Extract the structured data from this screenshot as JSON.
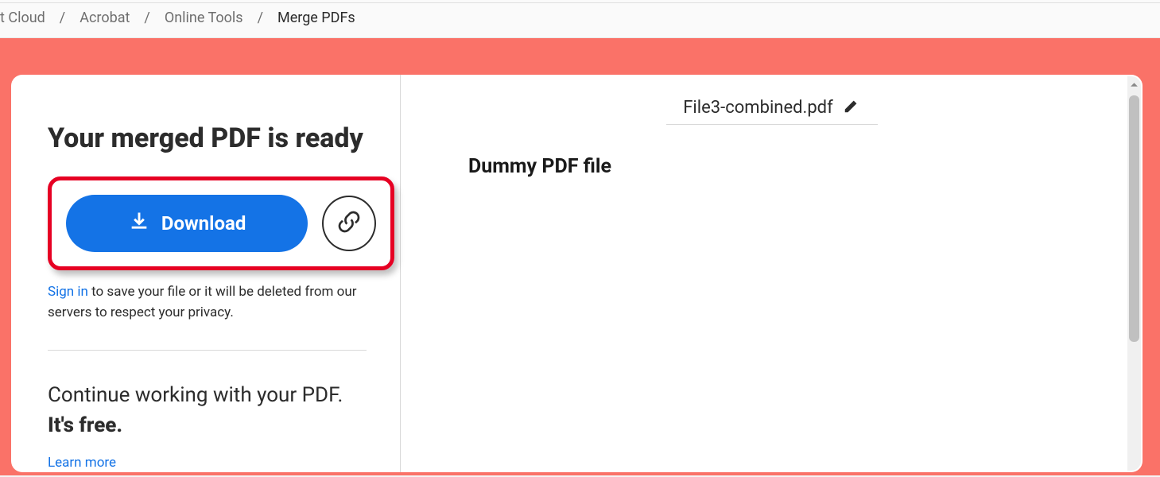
{
  "breadcrumb": {
    "items": [
      {
        "label": "t Cloud",
        "current": false
      },
      {
        "label": "Acrobat",
        "current": false
      },
      {
        "label": "Online Tools",
        "current": false
      },
      {
        "label": "Merge PDFs",
        "current": true
      }
    ],
    "separator": "/"
  },
  "panel": {
    "title": "Your merged PDF is ready",
    "download_label": "Download",
    "sign_in": "Sign in",
    "info_rest": " to save your file or it will be deleted from our servers to respect your privacy.",
    "continue_prefix": "Continue working with your PDF. ",
    "continue_free": "It's free.",
    "learn_more": "Learn more"
  },
  "preview": {
    "filename": "File3-combined.pdf",
    "content_heading": "Dummy PDF file"
  },
  "colors": {
    "accent_red_bg": "#fa7268",
    "highlight_border": "#e60023",
    "primary_blue": "#1473e6"
  }
}
